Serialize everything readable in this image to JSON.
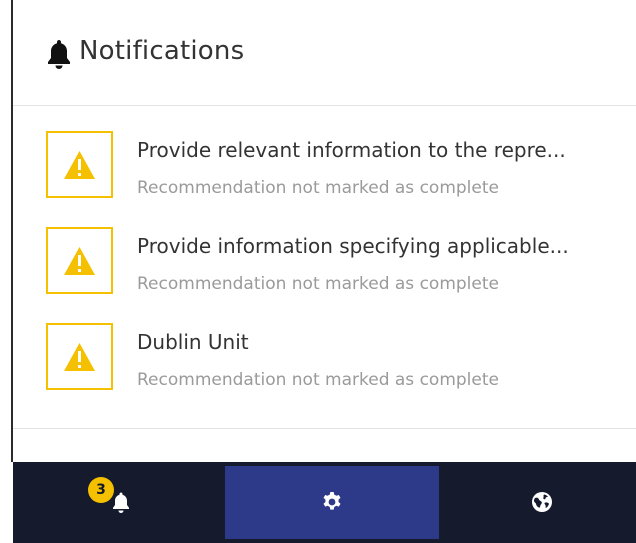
{
  "header": {
    "icon": "bell-icon",
    "title": "Notifications"
  },
  "notifications": [
    {
      "icon": "warning-icon",
      "title": "Provide relevant information to the repre...",
      "status": "Recommendation not marked as complete"
    },
    {
      "icon": "warning-icon",
      "title": "Provide information specifying applicable...",
      "status": "Recommendation not marked as complete"
    },
    {
      "icon": "warning-icon",
      "title": "Dublin Unit",
      "status": "Recommendation not marked as complete"
    }
  ],
  "bottom_nav": {
    "notifications": {
      "icon": "bell-icon",
      "badge_count": "3"
    },
    "settings": {
      "icon": "gear-icon",
      "active": true
    },
    "globe": {
      "icon": "globe-icon"
    }
  },
  "colors": {
    "warning": "#f5c000",
    "nav_background": "#151a2c",
    "nav_active": "#2d3a89",
    "text_primary": "#333333",
    "text_secondary": "#9a9a9a"
  }
}
